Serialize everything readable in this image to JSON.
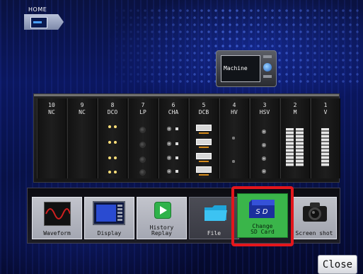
{
  "breadcrumb": {
    "home_label": "HOME"
  },
  "machine": {
    "label": "Machine"
  },
  "rack_slots": [
    {
      "number": "10",
      "name": "NC"
    },
    {
      "number": "9",
      "name": "NC"
    },
    {
      "number": "8",
      "name": "DCO"
    },
    {
      "number": "7",
      "name": "LP"
    },
    {
      "number": "6",
      "name": "CHA"
    },
    {
      "number": "5",
      "name": "DCB"
    },
    {
      "number": "4",
      "name": "HV"
    },
    {
      "number": "3",
      "name": "HSV"
    },
    {
      "number": "2",
      "name": "M"
    },
    {
      "number": "1",
      "name": "V"
    }
  ],
  "apps": {
    "waveform": "Waveform",
    "display": "Display",
    "history_replay": "History\nReplay",
    "file": "File",
    "change_sd_card": "Change\nSD Card",
    "screen_shot": "Screen shot"
  },
  "close_label": "Close",
  "colors": {
    "highlight": "#e3161c",
    "sd_card_tile": "#39b54a",
    "background": "#0b1760"
  }
}
